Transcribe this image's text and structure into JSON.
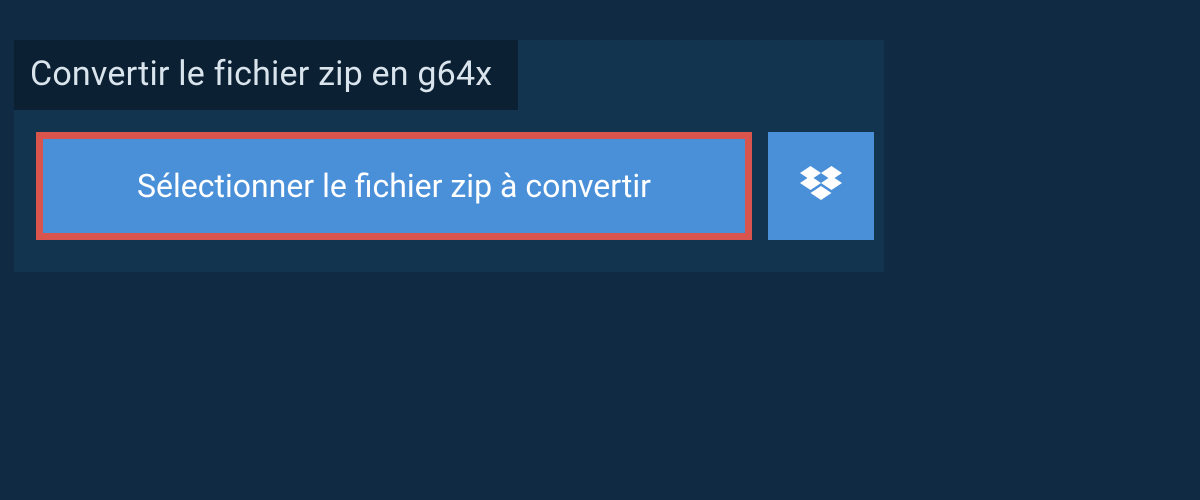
{
  "title": "Convertir le fichier zip en g64x",
  "select_button_label": "Sélectionner le fichier zip à convertir",
  "colors": {
    "page_bg": "#0f2a42",
    "panel_bg": "#12344e",
    "title_bg": "#0c2034",
    "button_bg": "#4a90d9",
    "highlight_border": "#d9544c",
    "title_text": "#d9e4ec",
    "button_text": "#ffffff"
  }
}
